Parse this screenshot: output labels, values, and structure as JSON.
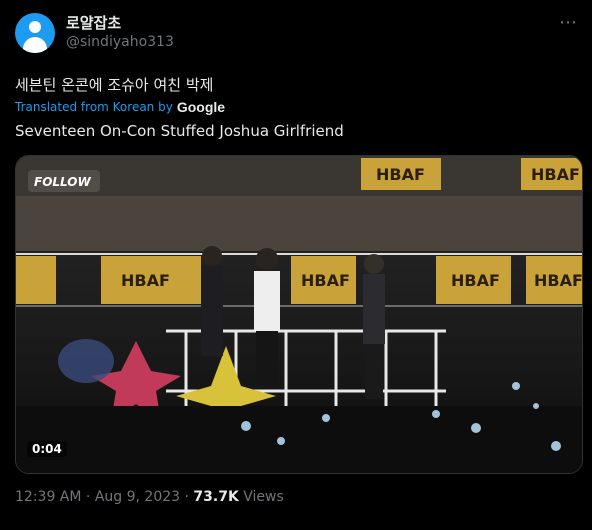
{
  "author": {
    "display_name": "로얄잡초",
    "handle": "@sindiyaho313"
  },
  "more_icon": "⋯",
  "tweet": {
    "text_original": "세븐틴 온콘에 조슈아 여친 박제",
    "translated_label": "Translated from Korean by",
    "translated_brand": "Google",
    "text_translated": "Seventeen On-Con Stuffed Joshua Girlfriend"
  },
  "media": {
    "overlay_logo": "FOLLOW",
    "banner_text": "HBAF",
    "video_time": "0:04"
  },
  "meta": {
    "time": "12:39 AM",
    "separator": "·",
    "date": "Aug 9, 2023",
    "views_count": "73.7K",
    "views_label": "Views"
  },
  "colors": {
    "background": "#000000",
    "accent": "#1d9bf0",
    "text_primary": "#e7e9ea",
    "text_secondary": "#71767b"
  }
}
